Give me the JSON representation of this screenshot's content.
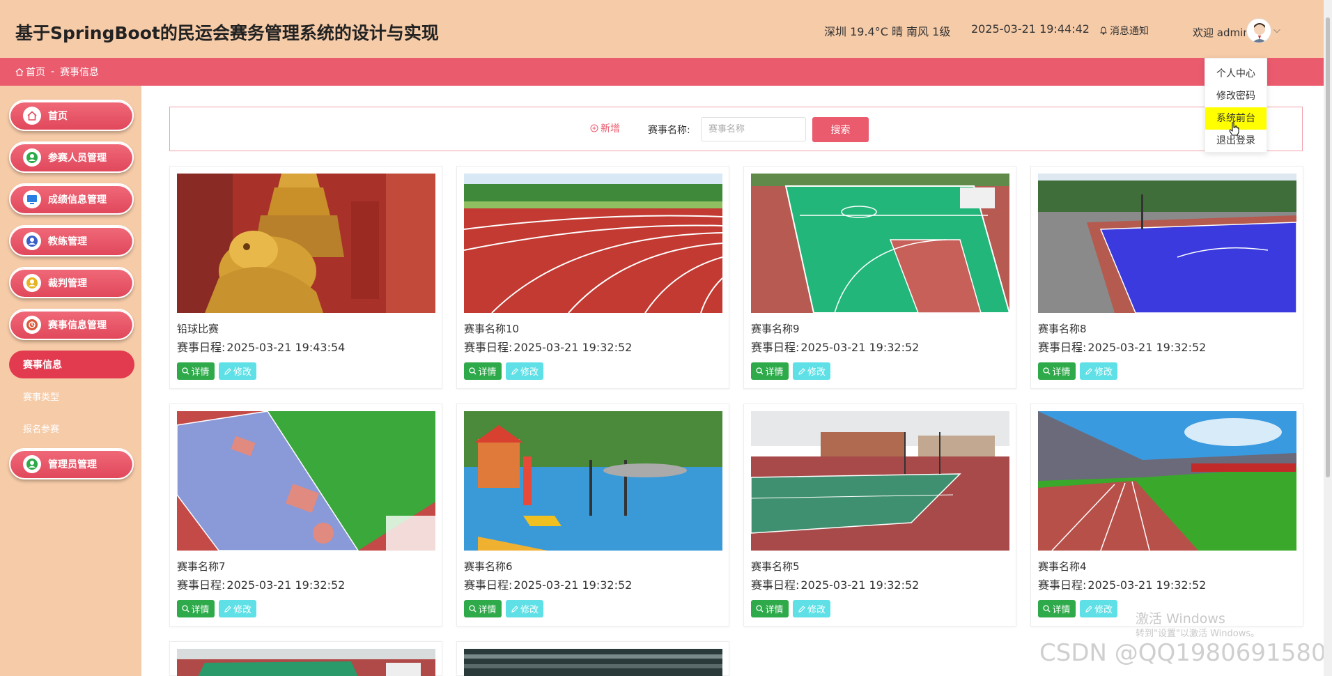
{
  "header": {
    "title": "基于SpringBoot的民运会赛务管理系统的设计与实现",
    "weather": "深圳 19.4°C 晴 南风 1级",
    "datetime": "2025-03-21 19:44:42",
    "notify": "消息通知",
    "welcome": "欢迎 admin"
  },
  "breadcrumb": {
    "home": "首页",
    "sep": "-",
    "current": "赛事信息"
  },
  "dropdown": {
    "items": [
      {
        "label": "个人中心",
        "active": false
      },
      {
        "label": "修改密码",
        "active": false
      },
      {
        "label": "系统前台",
        "active": true
      },
      {
        "label": "退出登录",
        "active": false
      }
    ]
  },
  "sidebar": {
    "items": [
      {
        "label": "首页",
        "icon": "home-icon"
      },
      {
        "label": "参赛人员管理",
        "icon": "participant-icon"
      },
      {
        "label": "成绩信息管理",
        "icon": "score-icon"
      },
      {
        "label": "教练管理",
        "icon": "coach-icon"
      },
      {
        "label": "裁判管理",
        "icon": "referee-icon"
      },
      {
        "label": "赛事信息管理",
        "icon": "event-icon"
      },
      {
        "label": "管理员管理",
        "icon": "admin-icon"
      }
    ],
    "sub_items": [
      {
        "label": "赛事信息",
        "active": true
      },
      {
        "label": "赛事类型",
        "active": false
      },
      {
        "label": "报名参赛",
        "active": false
      }
    ]
  },
  "search": {
    "add_label": "新增",
    "field_label": "赛事名称:",
    "placeholder": "赛事名称",
    "button": "搜索"
  },
  "cards": [
    {
      "name": "铅球比赛",
      "date_label": "赛事日程:",
      "date": "2025-03-21 19:43:54",
      "image": "golden-dragon-sculpture"
    },
    {
      "name": "赛事名称10",
      "date_label": "赛事日程:",
      "date": "2025-03-21 19:32:52",
      "image": "red-running-track"
    },
    {
      "name": "赛事名称9",
      "date_label": "赛事日程:",
      "date": "2025-03-21 19:32:52",
      "image": "green-basketball-court"
    },
    {
      "name": "赛事名称8",
      "date_label": "赛事日程:",
      "date": "2025-03-21 19:32:52",
      "image": "blue-basketball-court"
    },
    {
      "name": "赛事名称7",
      "date_label": "赛事日程:",
      "date": "2025-03-21 19:32:52",
      "image": "multi-sport-field"
    },
    {
      "name": "赛事名称6",
      "date_label": "赛事日程:",
      "date": "2025-03-21 19:32:52",
      "image": "playground"
    },
    {
      "name": "赛事名称5",
      "date_label": "赛事日程:",
      "date": "2025-03-21 19:32:52",
      "image": "tennis-court"
    },
    {
      "name": "赛事名称4",
      "date_label": "赛事日程:",
      "date": "2025-03-21 19:32:52",
      "image": "stadium-track"
    },
    {
      "name": "",
      "date_label": "",
      "date": "",
      "image": "court-partial"
    },
    {
      "name": "",
      "date_label": "",
      "date": "",
      "image": "indoor-partial"
    }
  ],
  "card_buttons": {
    "detail": "详情",
    "edit": "修改"
  },
  "watermark": {
    "line1": "激活 Windows",
    "line2": "转到\"设置\"以激活 Windows。",
    "csdn": "CSDN @QQ1980691580"
  },
  "colors": {
    "header_bg": "#f6cba8",
    "accent": "#ea5b6e",
    "detail_green": "#2eaa4a",
    "edit_cyan": "#5ee0e6",
    "highlight": "#ffff00"
  }
}
